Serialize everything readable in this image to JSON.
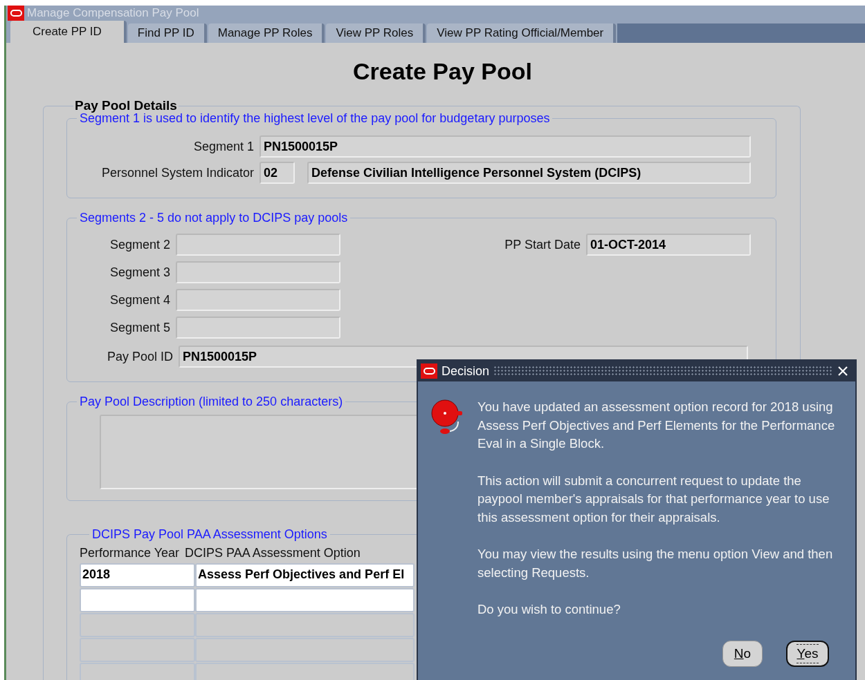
{
  "window": {
    "title": "Manage Compensation Pay Pool"
  },
  "tabs": [
    {
      "label": "Create PP ID",
      "selected": true
    },
    {
      "label": "Find PP ID",
      "selected": false
    },
    {
      "label": "Manage PP Roles",
      "selected": false
    },
    {
      "label": "View PP Roles",
      "selected": false
    },
    {
      "label": "View PP Rating Official/Member",
      "selected": false
    }
  ],
  "page_title": "Create Pay Pool",
  "details": {
    "title": "Pay Pool Details",
    "segment1_group": {
      "legend": "Segment 1 is used to identify the highest level of the pay pool for budgetary purposes",
      "segment1": {
        "label": "Segment 1",
        "value": "PN1500015P"
      },
      "psi": {
        "label": "Personnel System Indicator",
        "code": "02",
        "name": "Defense Civilian Intelligence Personnel System (DCIPS)"
      }
    },
    "segments_group": {
      "legend": "Segments 2 - 5 do not apply to DCIPS pay pools",
      "segments": [
        {
          "label": "Segment 2"
        },
        {
          "label": "Segment 3"
        },
        {
          "label": "Segment 4"
        },
        {
          "label": "Segment 5"
        }
      ],
      "start_date": {
        "label": "PP Start Date",
        "value": "01-OCT-2014"
      },
      "pay_pool_id": {
        "label": "Pay Pool ID",
        "value": "PN1500015P"
      }
    },
    "description": {
      "legend": "Pay Pool Description (limited to 250 characters)"
    },
    "assessment": {
      "legend": "DCIPS Pay Pool PAA Assessment Options",
      "columns": [
        "Performance Year",
        "DCIPS PAA Assessment Option"
      ],
      "rows": [
        {
          "cells": [
            "2018",
            "Assess Perf Objectives and Perf El"
          ],
          "enabled": true
        },
        {
          "enabled": true
        },
        {
          "enabled": false
        },
        {
          "enabled": false
        },
        {
          "enabled": false
        }
      ]
    }
  },
  "dialog": {
    "title": "Decision",
    "paragraphs": [
      "You have updated an assessment option record for 2018 using Assess Perf Objectives and Perf Elements for the Performance Eval in a Single Block.",
      "This action will submit a concurrent request to update the paypool member's appraisals for that performance year to use this assessment option for their appraisals.",
      "You may view the results using the menu option View and then selecting Requests.",
      "Do you wish to continue?"
    ],
    "buttons": [
      {
        "label": "No",
        "default": false
      },
      {
        "label": "Yes",
        "default": true
      }
    ]
  }
}
